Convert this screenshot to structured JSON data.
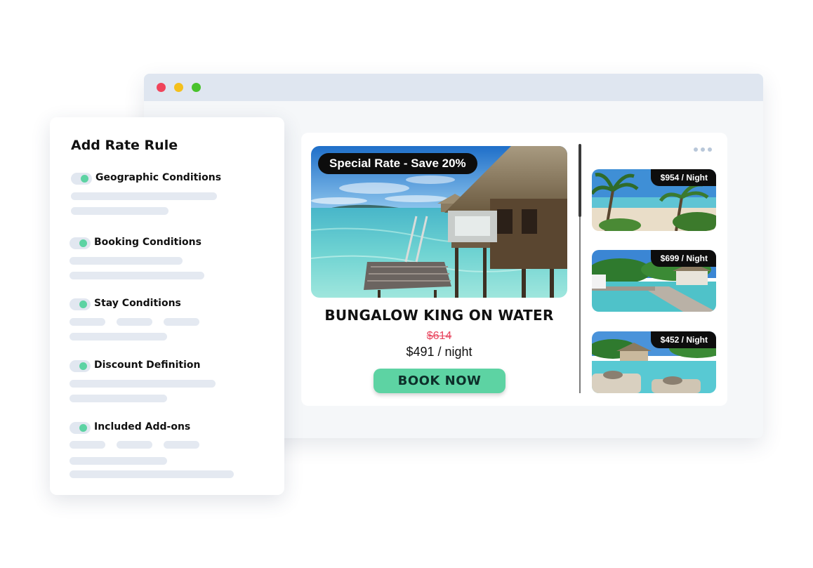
{
  "browser": {
    "traffic_lights": [
      "#f0445b",
      "#f4c01c",
      "#48c22c"
    ]
  },
  "listing": {
    "badge": "Special Rate - Save 20%",
    "title": "BUNGALOW KING ON WATER",
    "old_price": "$614",
    "new_price": "$491 / night",
    "book_label": "BOOK NOW",
    "accent_color": "#5dd3a3",
    "strike_color": "#e8455e"
  },
  "thumbnails": [
    {
      "price": "$954 / Night"
    },
    {
      "price": "$699 / Night"
    },
    {
      "price": "$452 / Night"
    }
  ],
  "rule_panel": {
    "title": "Add Rate Rule",
    "conditions": [
      {
        "label": "Geographic Conditions",
        "enabled": true
      },
      {
        "label": "Booking Conditions",
        "enabled": true
      },
      {
        "label": "Stay Conditions",
        "enabled": true
      },
      {
        "label": "Discount Definition",
        "enabled": true
      },
      {
        "label": "Included Add-ons",
        "enabled": true
      }
    ]
  },
  "icons": {
    "more": "more-horizontal-icon",
    "toggle": "toggle-on-icon"
  }
}
